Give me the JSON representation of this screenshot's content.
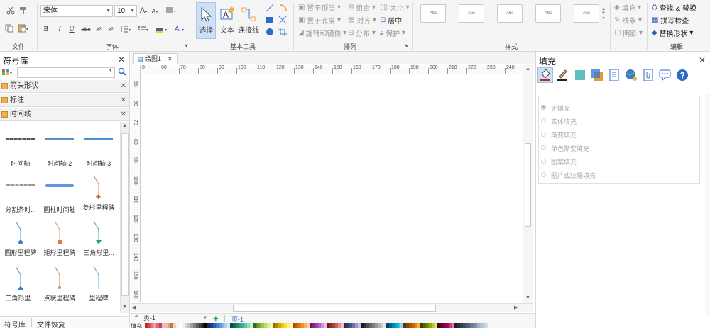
{
  "ribbon": {
    "groups": {
      "file": "文件",
      "font": "字体",
      "basic_tools": "基本工具",
      "arrange": "排列",
      "styles": "样式",
      "edit": "编辑"
    },
    "font_name": "宋体",
    "font_size": "10",
    "tools": {
      "select": "选择",
      "text": "文本",
      "connector": "连接线"
    },
    "arrange": {
      "bring_front": "置于顶层",
      "send_back": "置于底层",
      "rotate_mirror": "旋转和镜像",
      "group": "组合",
      "align": "对齐",
      "distribute": "分布",
      "size": "大小",
      "center": "居中",
      "protect": "保护"
    },
    "style_box": "Abc",
    "fill_ops": {
      "fill": "填充",
      "line": "线条",
      "shadow": "阴影"
    },
    "edit_ops": {
      "find_replace": "查找 & 替换",
      "spell_check": "拼写检查",
      "replace_shape": "替换形状"
    }
  },
  "left_panel": {
    "title": "符号库",
    "libraries": [
      "箭头形状",
      "标注",
      "时间线"
    ],
    "shapes": [
      "时间轴",
      "时间轴 2",
      "时间轴 3",
      "分割条时...",
      "圆柱时间轴",
      "菱形里程碑",
      "圆形里程碑",
      "矩形里程碑",
      "三角形里...",
      "三角形里...",
      "点状里程碑",
      "里程碑"
    ],
    "bottom_tabs": [
      "符号库",
      "文件恢复"
    ]
  },
  "document": {
    "tab_name": "绘图1",
    "h_ruler": [
      "0",
      "60",
      "70",
      "80",
      "90",
      "100",
      "110",
      "120",
      "130",
      "140",
      "150",
      "160",
      "170",
      "180",
      "190",
      "200",
      "210",
      "220",
      "230",
      "240"
    ],
    "v_ruler": [
      "50",
      "60",
      "70",
      "80",
      "90",
      "100",
      "110",
      "120",
      "130",
      "140",
      "150",
      "160"
    ],
    "page_selector": "页-1",
    "page_tab": "页-1",
    "fill_label": "填充"
  },
  "right_panel": {
    "title": "填充",
    "options": [
      "无填充",
      "实体填充",
      "渐变填充",
      "单色渐变填充",
      "图案填充",
      "图片或纹理填充"
    ]
  },
  "colors": {
    "accent": "#3a7bd5",
    "ribbon_bg": "#f5f5f5"
  }
}
